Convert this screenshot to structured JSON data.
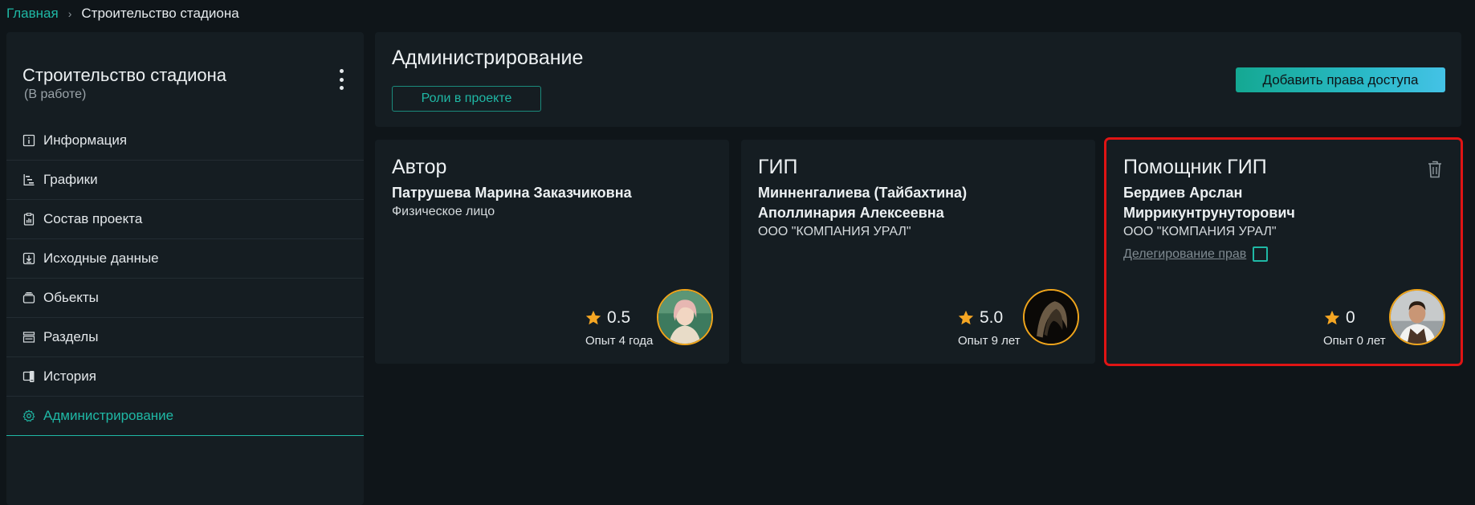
{
  "breadcrumb": {
    "home": "Главная",
    "separator": "›",
    "current": "Строительство стадиона"
  },
  "sidebar": {
    "project_title": "Строительство стадиона",
    "project_status": "(В работе)",
    "items": [
      {
        "label": "Информация",
        "icon": "info-icon"
      },
      {
        "label": "Графики",
        "icon": "gantt-chart-icon"
      },
      {
        "label": "Состав проекта",
        "icon": "clipboard-chart-icon"
      },
      {
        "label": "Исходные данные",
        "icon": "download-box-icon"
      },
      {
        "label": "Обьекты",
        "icon": "layers-icon"
      },
      {
        "label": "Разделы",
        "icon": "sections-icon"
      },
      {
        "label": "История",
        "icon": "history-devices-icon"
      },
      {
        "label": "Администрирование",
        "icon": "gear-icon",
        "active": true
      }
    ]
  },
  "header": {
    "title": "Администрирование",
    "roles_button": "Роли в проекте",
    "add_button": "Добавить права доступа"
  },
  "cards": [
    {
      "role": "Автор",
      "person": "Патрушева Марина Заказчиковна",
      "org": "Физическое лицо",
      "rating": "0.5",
      "experience": "Опыт 4 года"
    },
    {
      "role": "ГИП",
      "person": "Минненгалиева (Тайбахтина) Аполлинария Алексеевна",
      "org": "ООО \"КОМПАНИЯ УРАЛ\"",
      "rating": "5.0",
      "experience": "Опыт 9 лет"
    },
    {
      "role": "Помощник ГИП",
      "person": "Бердиев Арслан Миррикунтрунуторович",
      "org": "ООО \"КОМПАНИЯ УРАЛ\"",
      "delegation": "Делегирование прав",
      "delegation_checked": false,
      "rating": "0",
      "experience": "Опыт 0 лет"
    }
  ],
  "colors": {
    "accent": "#1fb8a5",
    "star": "#f5a623",
    "avatar_ring": "#f0a51b",
    "selection": "#e01414",
    "panel": "#151d22",
    "background": "#0f1519"
  }
}
